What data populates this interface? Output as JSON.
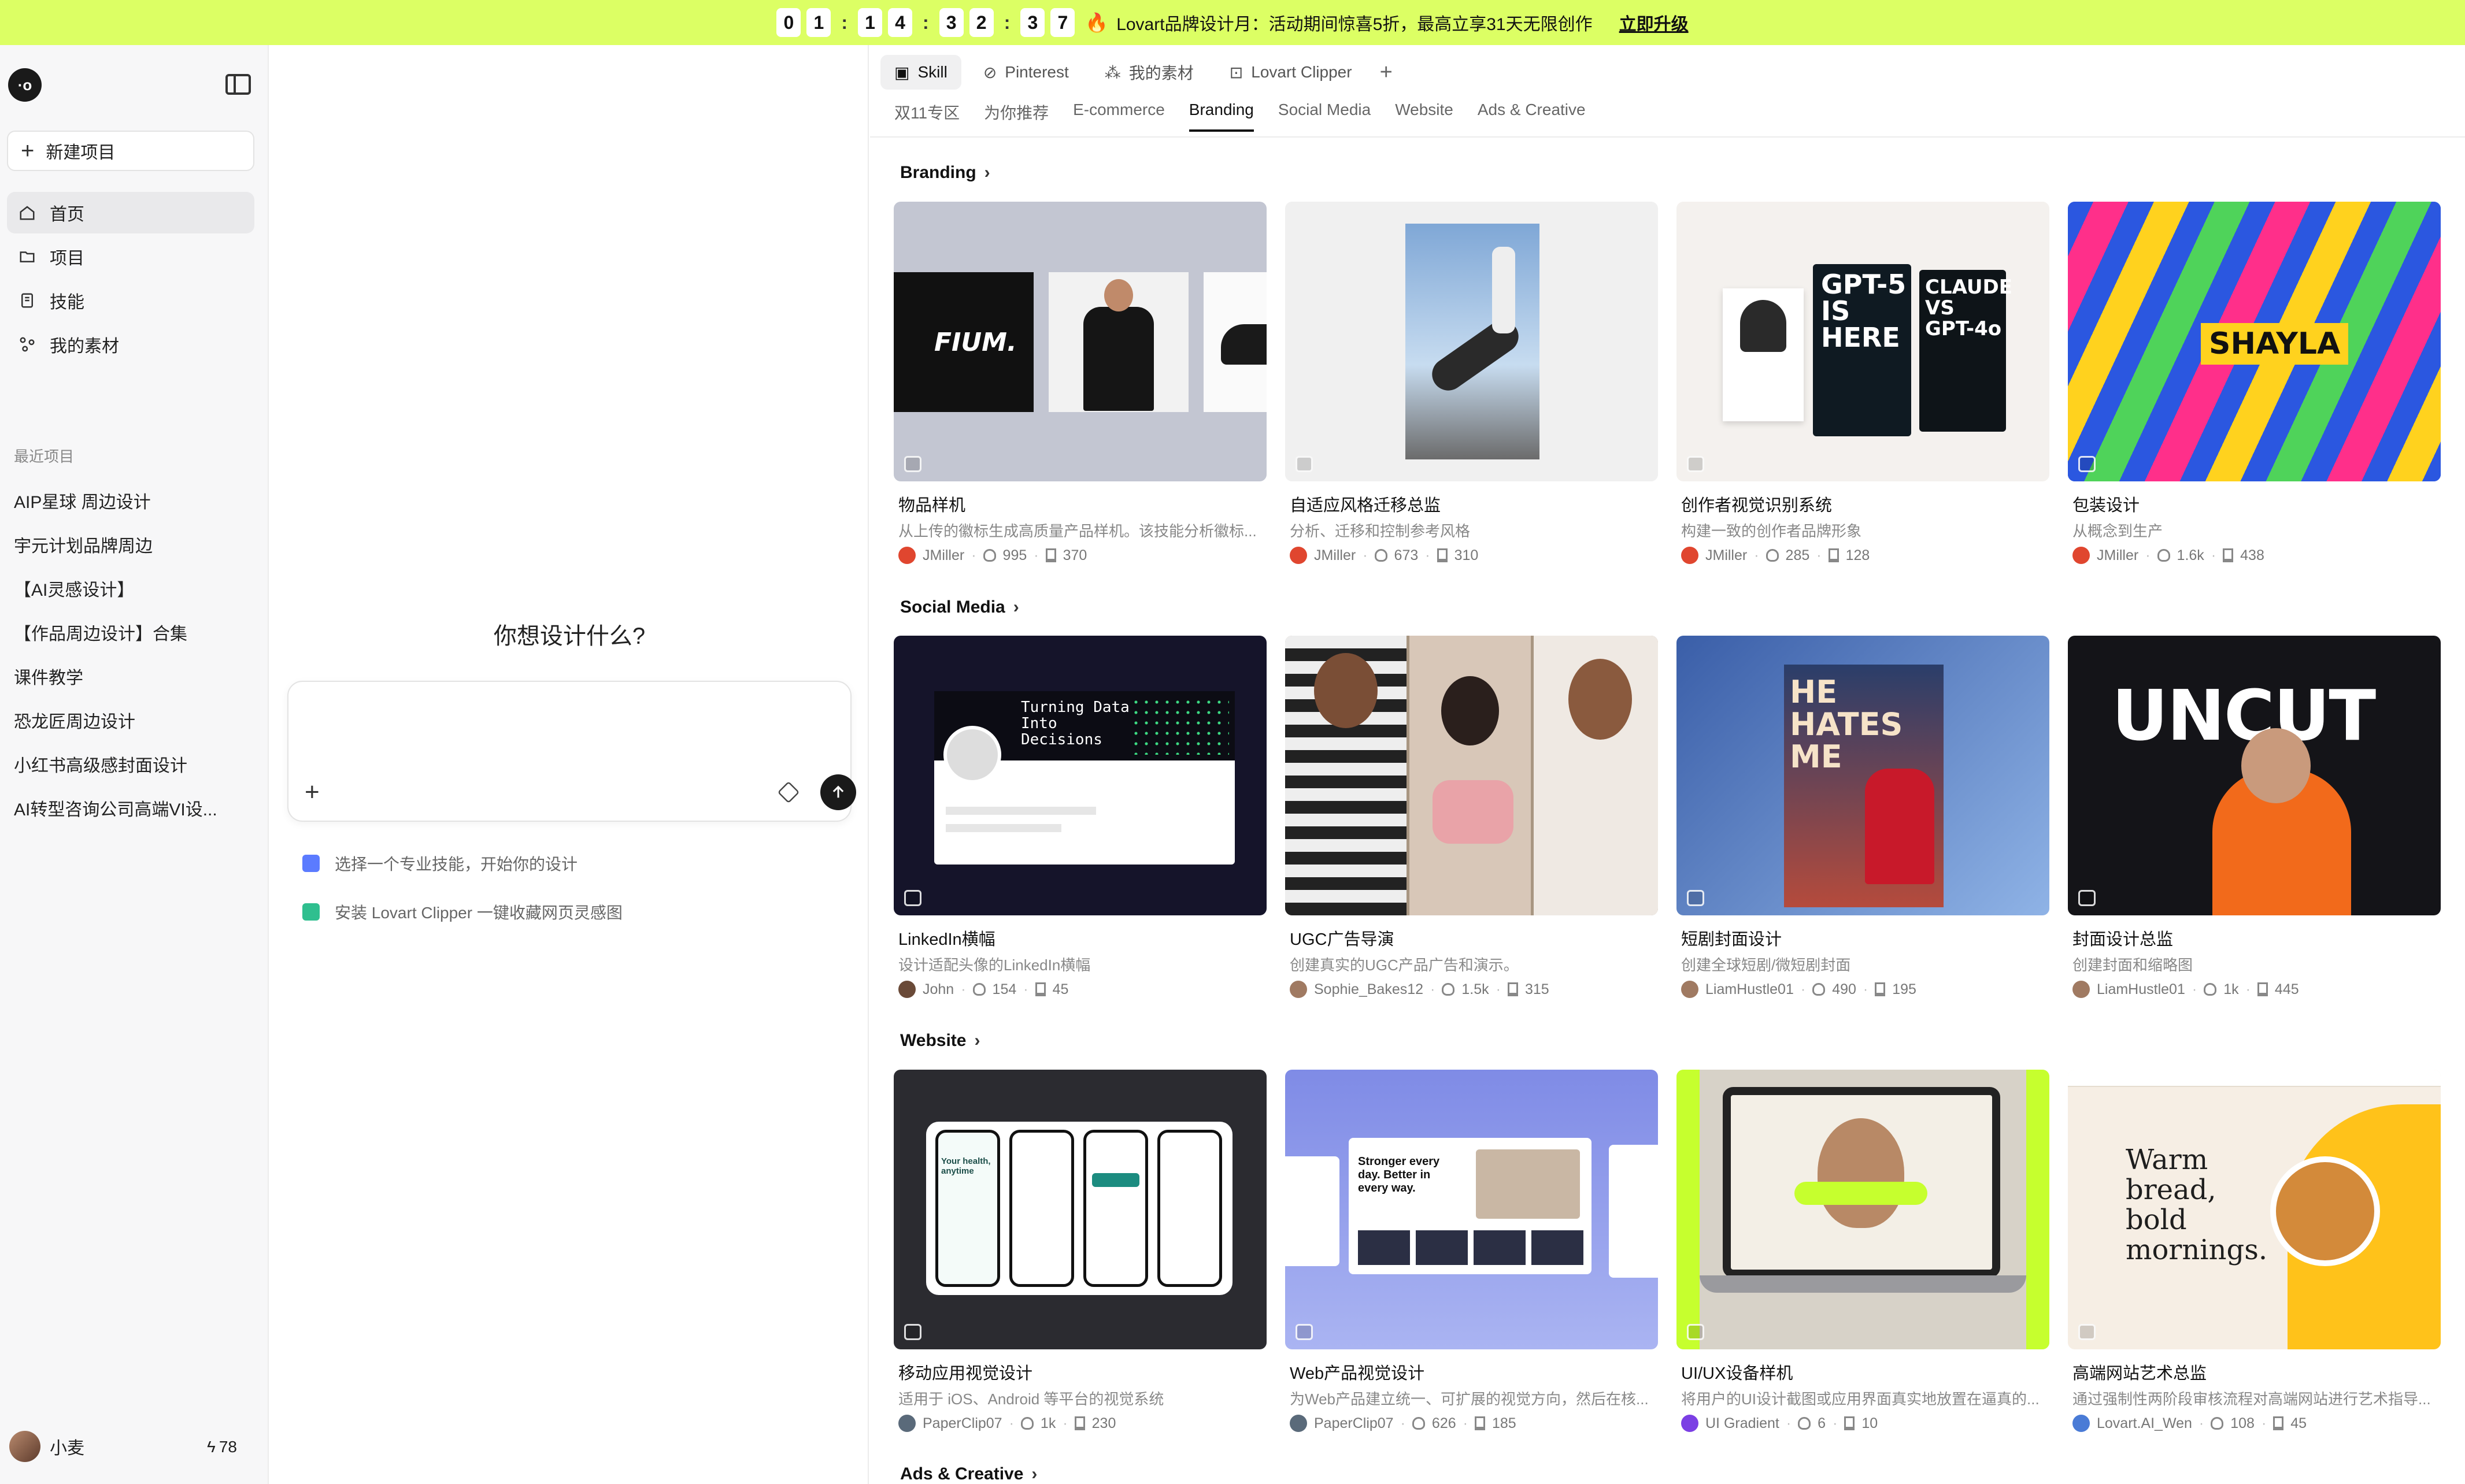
{
  "banner": {
    "countdown_digits": [
      "0",
      "1",
      "1",
      "4",
      "3",
      "2",
      "3",
      "7"
    ],
    "fire_icon": "fire-icon",
    "promo_text": "Lovart品牌设计月：活动期间惊喜5折，最高立享31天无限创作",
    "upgrade_label": "立即升级",
    "color": "#dcff64"
  },
  "sidebar": {
    "new_project_label": "新建项目",
    "nav": [
      {
        "label": "首页",
        "icon": "home-icon"
      },
      {
        "label": "项目",
        "icon": "folder-icon"
      },
      {
        "label": "技能",
        "icon": "skill-icon"
      },
      {
        "label": "我的素材",
        "icon": "assets-icon"
      }
    ],
    "recent_title": "最近项目",
    "recent": [
      "AIP星球 周边设计",
      "宇元计划品牌周边",
      "【AI灵感设计】",
      "【作品周边设计】合集",
      "课件教学",
      "恐龙匠周边设计",
      "小红书高级感封面设计",
      "AI转型咨询公司高端VI设..."
    ],
    "user_name": "小麦",
    "credits": "78"
  },
  "chat": {
    "title": "你想设计什么?",
    "input_value": "",
    "hints": [
      "选择一个专业技能，开始你的设计",
      "安装 Lovart Clipper 一键收藏网页灵感图"
    ]
  },
  "main": {
    "top_tabs": [
      {
        "label": "Skill",
        "icon": "skill-icon"
      },
      {
        "label": "Pinterest",
        "icon": "pinterest-icon"
      },
      {
        "label": "我的素材",
        "icon": "assets-icon"
      },
      {
        "label": "Lovart Clipper",
        "icon": "clipper-icon"
      }
    ],
    "sub_tabs": [
      "双11专区",
      "为你推荐",
      "E-commerce",
      "Branding",
      "Social Media",
      "Website",
      "Ads & Creative"
    ],
    "sections": [
      {
        "title": "Branding",
        "cards": [
          {
            "title": "物品样机",
            "desc": "从上传的徽标生成高质量产品样机。该技能分析徽标...",
            "author": "JMiller",
            "uses": "995",
            "saves": "370"
          },
          {
            "title": "自适应风格迁移总监",
            "desc": "分析、迁移和控制参考风格",
            "author": "JMiller",
            "uses": "673",
            "saves": "310"
          },
          {
            "title": "创作者视觉识别系统",
            "desc": "构建一致的创作者品牌形象",
            "author": "JMiller",
            "uses": "285",
            "saves": "128"
          },
          {
            "title": "包装设计",
            "desc": "从概念到生产",
            "author": "JMiller",
            "uses": "1.6k",
            "saves": "438"
          }
        ]
      },
      {
        "title": "Social Media",
        "cards": [
          {
            "title": "LinkedIn横幅",
            "desc": "设计适配头像的LinkedIn横幅",
            "author": "John",
            "uses": "154",
            "saves": "45"
          },
          {
            "title": "UGC广告导演",
            "desc": "创建真实的UGC产品广告和演示。",
            "author": "Sophie_Bakes12",
            "uses": "1.5k",
            "saves": "315"
          },
          {
            "title": "短剧封面设计",
            "desc": "创建全球短剧/微短剧封面",
            "author": "LiamHustle01",
            "uses": "490",
            "saves": "195"
          },
          {
            "title": "封面设计总监",
            "desc": "创建封面和缩略图",
            "author": "LiamHustle01",
            "uses": "1k",
            "saves": "445"
          }
        ]
      },
      {
        "title": "Website",
        "cards": [
          {
            "title": "移动应用视觉设计",
            "desc": "适用于 iOS、Android 等平台的视觉系统",
            "author": "PaperClip07",
            "uses": "1k",
            "saves": "230"
          },
          {
            "title": "Web产品视觉设计",
            "desc": "为Web产品建立统一、可扩展的视觉方向，然后在核...",
            "author": "PaperClip07",
            "uses": "626",
            "saves": "185"
          },
          {
            "title": "UI/UX设备样机",
            "desc": "将用户的UI设计截图或应用界面真实地放置在逼真的...",
            "author": "UI Gradient",
            "uses": "6",
            "saves": "10"
          },
          {
            "title": "高端网站艺术总监",
            "desc": "通过强制性两阶段审核流程对高端网站进行艺术指导...",
            "author": "Lovart.AI_Wen",
            "uses": "108",
            "saves": "45"
          }
        ]
      },
      {
        "title": "Ads & Creative",
        "cards": []
      }
    ],
    "thumb_texts": {
      "fium": "FIUM.",
      "gpt5": "GPT-5 IS HERE",
      "claude": "CLAUDE VS GPT-4o",
      "shayla": "SHAYLA",
      "linkedin": "Turning Data Into Decisions",
      "hates": "HE HATES ME",
      "uncut": "UNCUT",
      "health": "Your health, anytime",
      "web": "Stronger every day. Better in every way.",
      "warm": "Warm bread, bold mornings."
    }
  }
}
